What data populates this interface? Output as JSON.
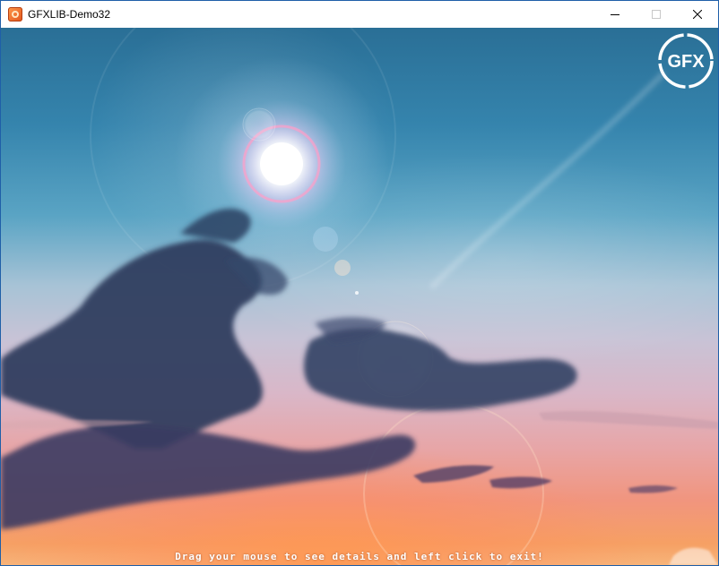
{
  "window": {
    "title": "GFXLIB-Demo32",
    "app_icon": "gfxlib-app-icon"
  },
  "controls": {
    "minimize": "minimize-icon",
    "maximize": "maximize-icon",
    "close": "close-icon"
  },
  "canvas": {
    "scene": "sunset-sky-with-sun-and-lens-flare",
    "logo_text": "GFX",
    "hint": "Drag your mouse to see details and left click to exit!"
  },
  "colors": {
    "sky_top": "#2a6f96",
    "sky_mid": "#a7c3d6",
    "sky_bottom": "#f7b47a",
    "cloud": "#2b3a5c",
    "title_bar": "#ffffff",
    "window_border": "#1f5fa8",
    "hint_text": "#ffffff"
  }
}
